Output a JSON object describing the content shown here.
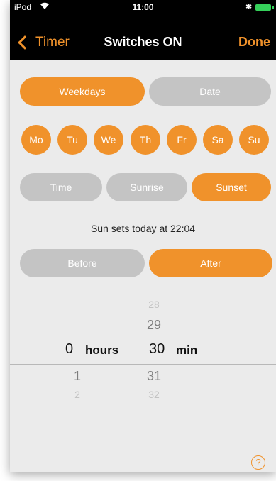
{
  "status_bar": {
    "carrier": "iPod",
    "time": "11:00",
    "wifi_icon": "wifi-icon",
    "bluetooth_icon": "bluetooth-icon",
    "battery_icon": "battery-icon"
  },
  "nav": {
    "back_label": "Timer",
    "title": "Switches ON",
    "done_label": "Done"
  },
  "mode_tabs": {
    "weekdays": "Weekdays",
    "date": "Date",
    "selected": "Weekdays"
  },
  "days": [
    "Mo",
    "Tu",
    "We",
    "Th",
    "Fr",
    "Sa",
    "Su"
  ],
  "time_tabs": {
    "time": "Time",
    "sunrise": "Sunrise",
    "sunset": "Sunset",
    "selected": "Sunset"
  },
  "info": "Sun sets today at 22:04",
  "offset_tabs": {
    "before": "Before",
    "after": "After",
    "selected": "After"
  },
  "picker": {
    "hours": {
      "value": "0",
      "unit": "hours",
      "below1": "1",
      "below2": "2"
    },
    "minutes": {
      "above2": "28",
      "above1": "29",
      "value": "30",
      "unit": "min",
      "below1": "31",
      "below2": "32"
    }
  },
  "help_label": "?",
  "colors": {
    "accent": "#f0922b",
    "inactive": "#c4c4c4",
    "background": "#ebebeb",
    "bar": "#000000"
  }
}
